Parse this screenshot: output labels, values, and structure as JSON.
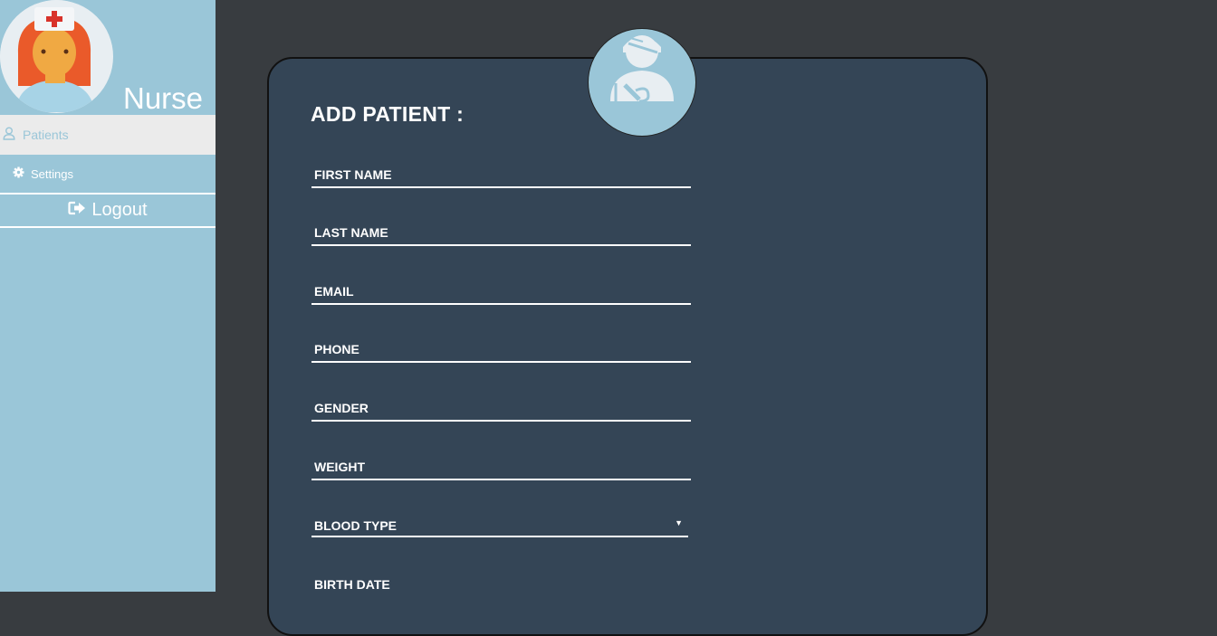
{
  "sidebar": {
    "role": "Nurse",
    "nav": [
      {
        "label": "Patients",
        "icon": "user-icon",
        "active": true
      },
      {
        "label": "Settings",
        "icon": "gear-icon",
        "active": false
      }
    ],
    "logout_label": "Logout"
  },
  "form": {
    "title": "ADD PATIENT :",
    "fields": {
      "first_name": "FIRST NAME",
      "last_name": "LAST NAME",
      "email": "EMAIL",
      "phone": "PHONE",
      "gender": "GENDER",
      "weight": "WEIGHT",
      "blood_type": "BLOOD TYPE",
      "birth_date": "BIRTH DATE"
    }
  },
  "colors": {
    "sidebar": "#9ac6d8",
    "background": "#383c40",
    "card": "#344556",
    "active_nav": "#ebebeb"
  }
}
